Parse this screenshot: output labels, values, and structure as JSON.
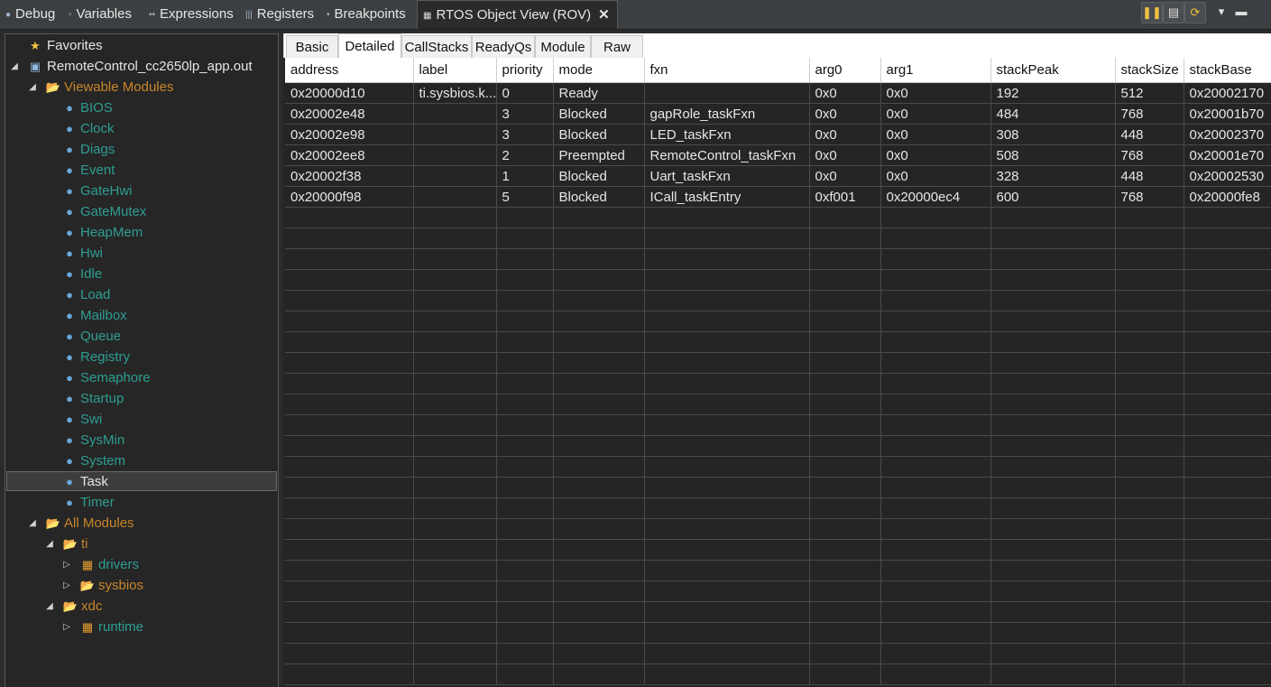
{
  "view_tabs": {
    "debug": "Debug",
    "variables": "Variables",
    "expressions": "Expressions",
    "registers": "Registers",
    "breakpoints": "Breakpoints",
    "rov": "RTOS Object View (ROV)"
  },
  "tree": {
    "favorites": "Favorites",
    "project": "RemoteControl_cc2650lp_app.out",
    "viewable_modules": "Viewable Modules",
    "modules": [
      "BIOS",
      "Clock",
      "Diags",
      "Event",
      "GateHwi",
      "GateMutex",
      "HeapMem",
      "Hwi",
      "Idle",
      "Load",
      "Mailbox",
      "Queue",
      "Registry",
      "Semaphore",
      "Startup",
      "Swi",
      "SysMin",
      "System",
      "Task",
      "Timer"
    ],
    "selected": "Task",
    "all_modules": "All Modules",
    "ti": "ti",
    "drivers": "drivers",
    "sysbios": "sysbios",
    "xdc": "xdc",
    "runtime": "runtime"
  },
  "subtabs": [
    "Basic",
    "Detailed",
    "CallStacks",
    "ReadyQs",
    "Module",
    "Raw"
  ],
  "active_subtab": "Detailed",
  "table": {
    "columns": [
      "address",
      "label",
      "priority",
      "mode",
      "fxn",
      "arg0",
      "arg1",
      "stackPeak",
      "stackSize",
      "stackBase"
    ],
    "rows": [
      [
        "0x20000d10",
        "ti.sysbios.k...",
        "0",
        "Ready",
        "",
        "0x0",
        "0x0",
        "192",
        "512",
        "0x20002170"
      ],
      [
        "0x20002e48",
        "",
        "3",
        "Blocked",
        "gapRole_taskFxn",
        "0x0",
        "0x0",
        "484",
        "768",
        "0x20001b70"
      ],
      [
        "0x20002e98",
        "",
        "3",
        "Blocked",
        "LED_taskFxn",
        "0x0",
        "0x0",
        "308",
        "448",
        "0x20002370"
      ],
      [
        "0x20002ee8",
        "",
        "2",
        "Preempted",
        "RemoteControl_taskFxn",
        "0x0",
        "0x0",
        "508",
        "768",
        "0x20001e70"
      ],
      [
        "0x20002f38",
        "",
        "1",
        "Blocked",
        "Uart_taskFxn",
        "0x0",
        "0x0",
        "328",
        "448",
        "0x20002530"
      ],
      [
        "0x20000f98",
        "",
        "5",
        "Blocked",
        "ICall_taskEntry",
        "0xf001",
        "0x20000ec4",
        "600",
        "768",
        "0x20000fe8"
      ]
    ]
  },
  "colors": {
    "background": "#2b2b2b",
    "module_text": "#2e9e92",
    "folder_text": "#c8862a"
  }
}
